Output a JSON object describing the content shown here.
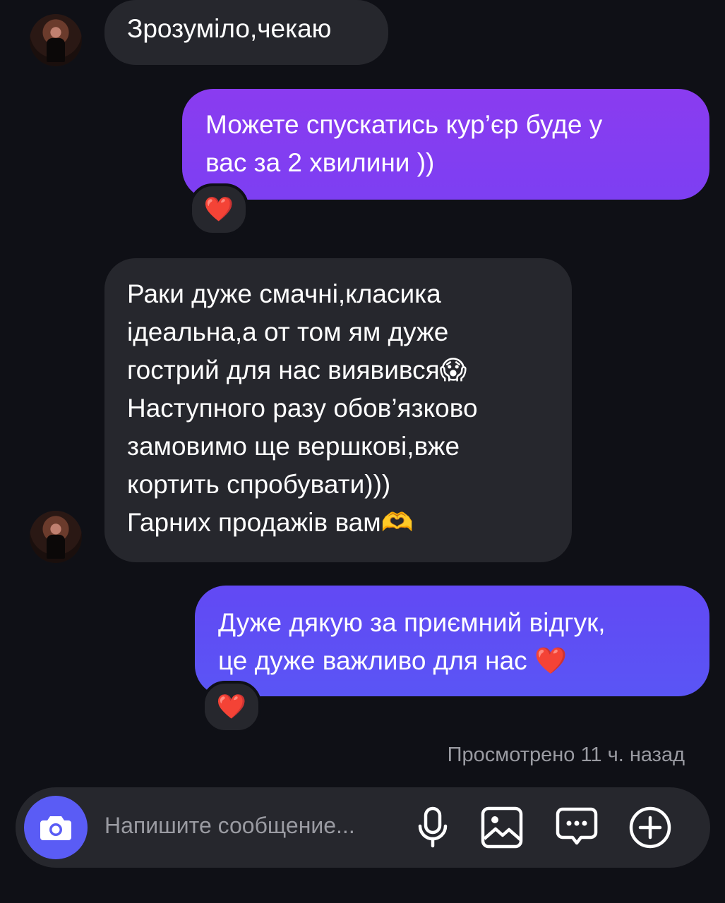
{
  "thread": {
    "messages": [
      {
        "side": "in",
        "text": "Зрозуміло,чекаю"
      },
      {
        "side": "out",
        "text": "Можете спускатись кур’єр буде у\nвас за 2 хвилини ))",
        "reaction": "❤️"
      },
      {
        "side": "in",
        "text": "Раки дуже смачні,класика\nідеальна,а от том ям дуже\nгострий для нас виявився😱\nНаступного разу обов’язково\nзамовимо ще вершкові,вже\nкортить спробувати)))\nГарних продажів вам🫶"
      },
      {
        "side": "out",
        "text": "Дуже дякую за приємний відгук,\nце дуже важливо для нас  ❤️",
        "reaction": "❤️"
      }
    ],
    "seen_status": "Просмотрено 11 ч. назад"
  },
  "composer": {
    "placeholder": "Напишите сообщение..."
  },
  "colors": {
    "background": "#0f1016",
    "incoming_bubble": "#26272d",
    "outgoing_gradient_top": "#8a3cf0",
    "outgoing_gradient_bottom": "#5a55f5",
    "camera_button": "#5a5cf5"
  },
  "icons": {
    "camera": "camera-icon",
    "microphone": "microphone-icon",
    "gallery": "image-icon",
    "sticker": "chat-bubble-icon",
    "more": "plus-circle-icon"
  }
}
